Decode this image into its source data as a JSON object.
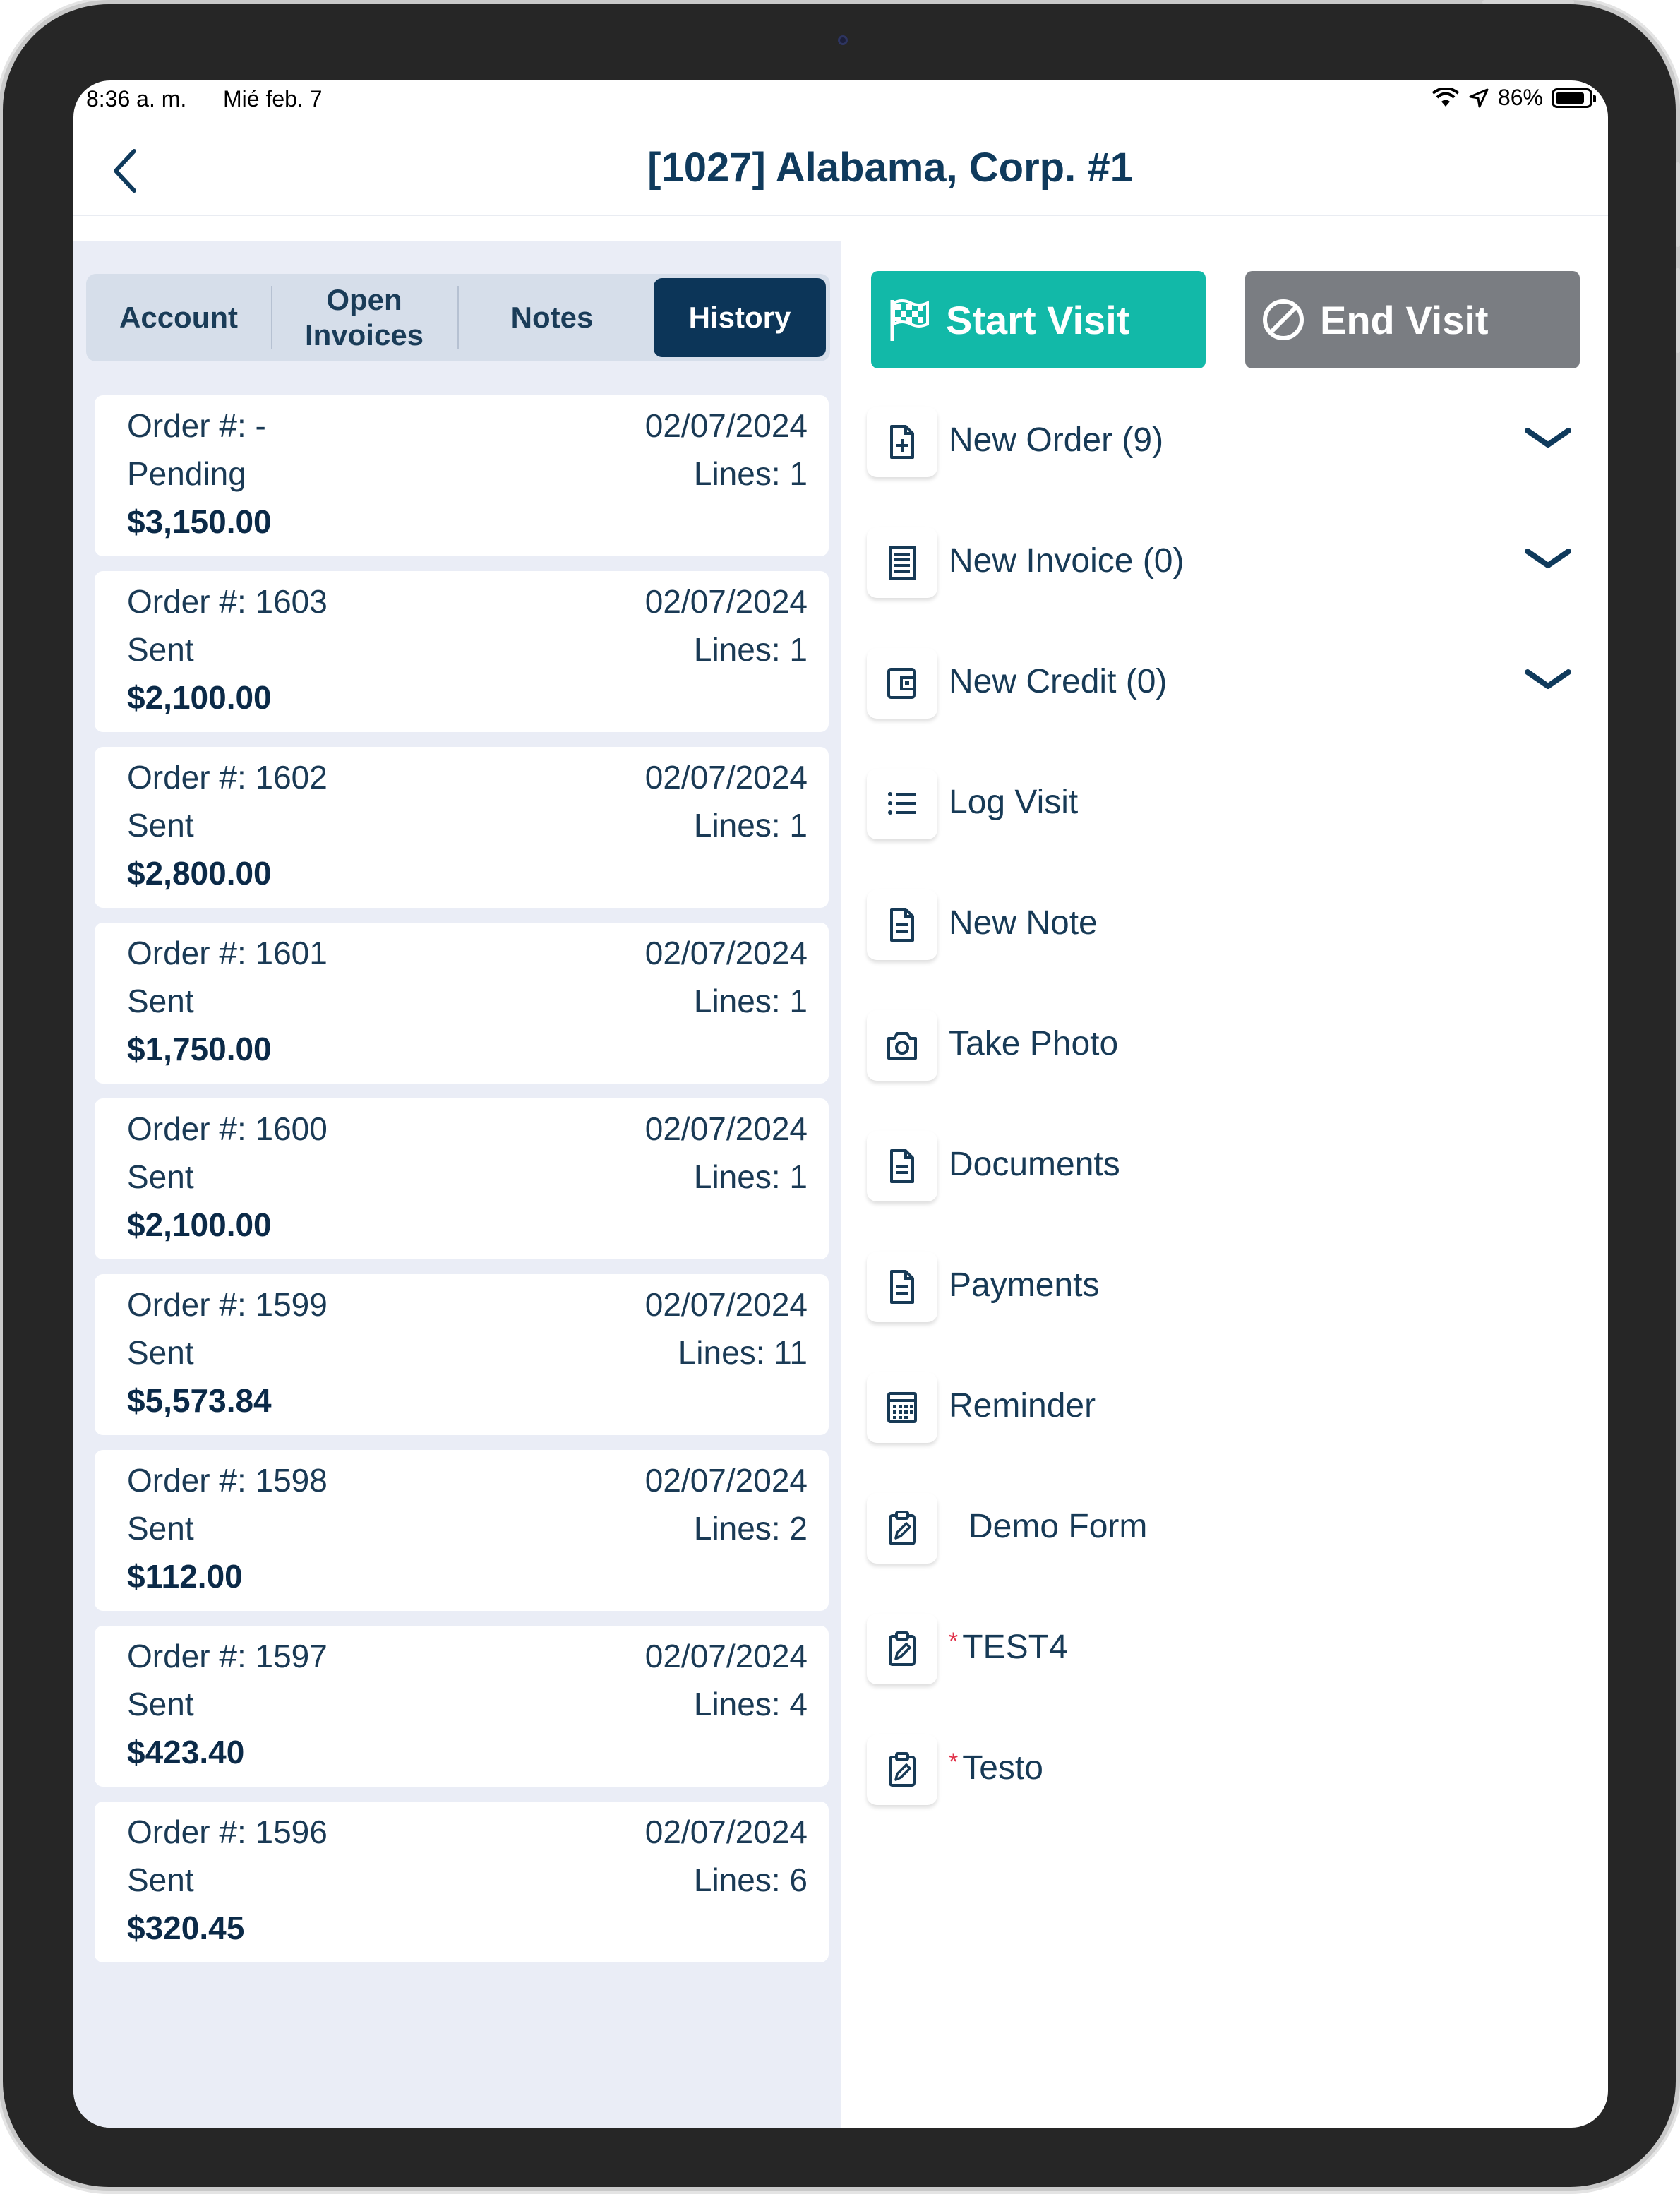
{
  "status_bar": {
    "time": "8:36 a. m.",
    "date": "Mié feb. 7",
    "battery": "86%",
    "battery_level": 0.86
  },
  "header": {
    "title": "[1027] Alabama, Corp. #1"
  },
  "tabs": [
    {
      "label": "Account",
      "active": false
    },
    {
      "label": "Open\nInvoices",
      "active": false
    },
    {
      "label": "Notes",
      "active": false
    },
    {
      "label": "History",
      "active": true
    }
  ],
  "orders": [
    {
      "order": "Order #: -",
      "status": "Pending",
      "amount": "$3,150.00",
      "date": "02/07/2024",
      "lines": "Lines: 1"
    },
    {
      "order": "Order #: 1603",
      "status": "Sent",
      "amount": "$2,100.00",
      "date": "02/07/2024",
      "lines": "Lines: 1"
    },
    {
      "order": "Order #: 1602",
      "status": "Sent",
      "amount": "$2,800.00",
      "date": "02/07/2024",
      "lines": "Lines: 1"
    },
    {
      "order": "Order #: 1601",
      "status": "Sent",
      "amount": "$1,750.00",
      "date": "02/07/2024",
      "lines": "Lines: 1"
    },
    {
      "order": "Order #: 1600",
      "status": "Sent",
      "amount": "$2,100.00",
      "date": "02/07/2024",
      "lines": "Lines: 1"
    },
    {
      "order": "Order #: 1599",
      "status": "Sent",
      "amount": "$5,573.84",
      "date": "02/07/2024",
      "lines": "Lines: 11"
    },
    {
      "order": "Order #: 1598",
      "status": "Sent",
      "amount": "$112.00",
      "date": "02/07/2024",
      "lines": "Lines: 2"
    },
    {
      "order": "Order #: 1597",
      "status": "Sent",
      "amount": "$423.40",
      "date": "02/07/2024",
      "lines": "Lines: 4"
    },
    {
      "order": "Order #: 1596",
      "status": "Sent",
      "amount": "$320.45",
      "date": "02/07/2024",
      "lines": "Lines: 6"
    }
  ],
  "visit_buttons": {
    "start": "Start Visit",
    "end": "End Visit"
  },
  "actions": [
    {
      "label": "New Order (9)",
      "icon": "file-plus-icon",
      "expandable": true,
      "required": false
    },
    {
      "label": "New Invoice (0)",
      "icon": "receipt-icon",
      "expandable": true,
      "required": false
    },
    {
      "label": "New Credit (0)",
      "icon": "wallet-icon",
      "expandable": true,
      "required": false
    },
    {
      "label": "Log Visit",
      "icon": "list-icon",
      "expandable": false,
      "required": false
    },
    {
      "label": "New Note",
      "icon": "document-icon",
      "expandable": false,
      "required": false
    },
    {
      "label": "Take Photo",
      "icon": "camera-icon",
      "expandable": false,
      "required": false
    },
    {
      "label": "Documents",
      "icon": "document-icon",
      "expandable": false,
      "required": false
    },
    {
      "label": "Payments",
      "icon": "document-icon",
      "expandable": false,
      "required": false
    },
    {
      "label": "Reminder",
      "icon": "calendar-icon",
      "expandable": false,
      "required": false
    },
    {
      "label": "Demo Form",
      "icon": "clipboard-edit-icon",
      "expandable": false,
      "required": false
    },
    {
      "label": "TEST4",
      "icon": "clipboard-edit-icon",
      "expandable": false,
      "required": true
    },
    {
      "label": "Testo",
      "icon": "clipboard-edit-icon",
      "expandable": false,
      "required": true
    }
  ],
  "required_marker": "*",
  "colors": {
    "primary": "#0c3558",
    "accent": "#12b9a8",
    "end_button": "#7a7d82",
    "panel_bg": "#eaedf6",
    "required": "#e0324a"
  }
}
